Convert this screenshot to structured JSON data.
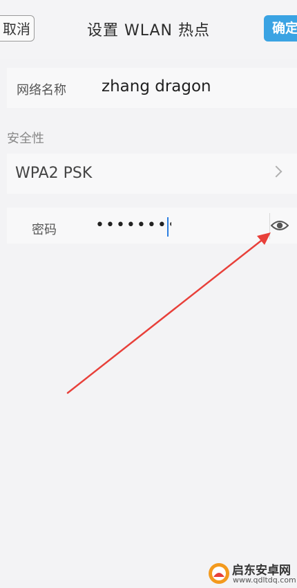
{
  "header": {
    "cancel_label": "取消",
    "title": "设置 WLAN 热点",
    "confirm_label": "确定"
  },
  "ssid": {
    "label": "网络名称",
    "value": "zhang dragon"
  },
  "security": {
    "section_label": "安全性",
    "value": "WPA2 PSK",
    "chevron_icon": "chevron-right-icon"
  },
  "password": {
    "label": "密码",
    "masked_value": "••••••••",
    "toggle_icon": "eye-icon"
  },
  "watermark": {
    "title": "启东安卓网",
    "url": "www.qdltdq.com"
  },
  "colors": {
    "accent": "#3aa3e3",
    "annotation_arrow": "#e8403a",
    "background": "#f3f3f5"
  }
}
